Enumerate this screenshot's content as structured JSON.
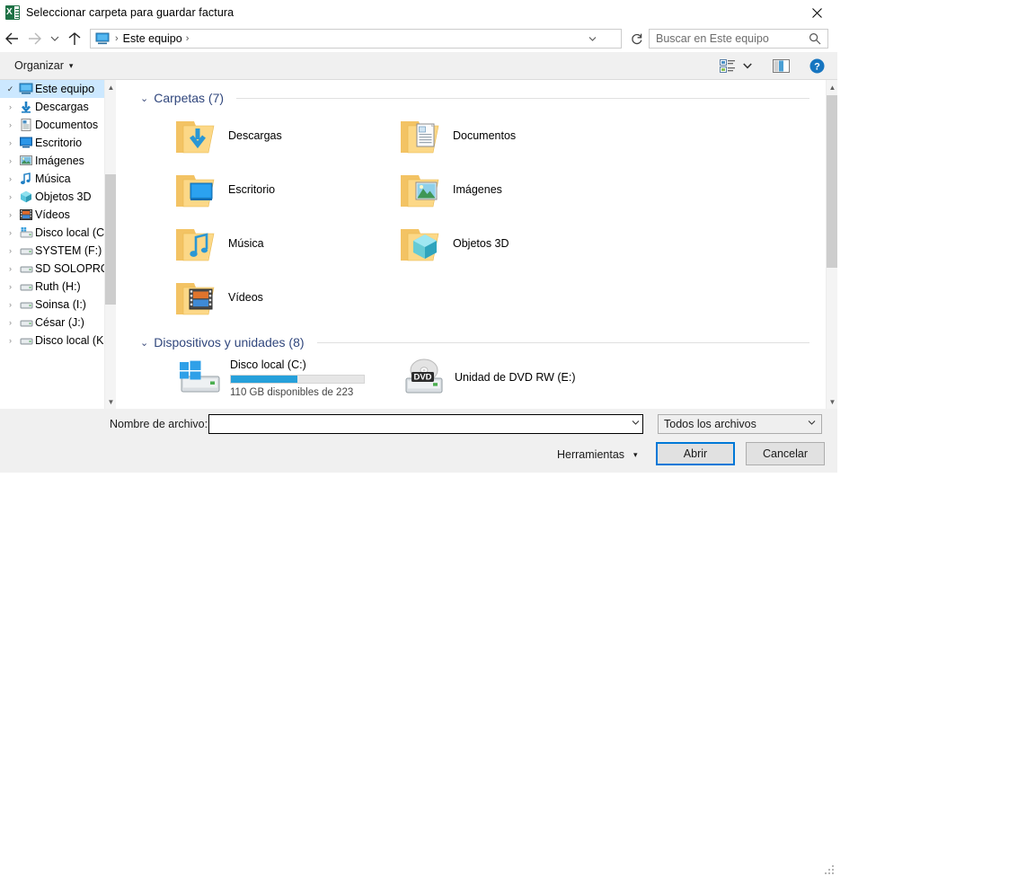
{
  "window": {
    "title": "Seleccionar carpeta para guardar factura",
    "app_icon": "excel-icon",
    "close_label": "✕"
  },
  "nav": {
    "back_icon": "arrow-left-icon",
    "forward_icon": "arrow-right-icon",
    "recent_icon": "chevron-down-icon",
    "up_icon": "arrow-up-icon",
    "breadcrumb": {
      "root_icon": "this-pc-icon",
      "sep1": "›",
      "item": "Este equipo",
      "sep2": "›"
    },
    "address_dropdown_icon": "chevron-down-icon",
    "refresh_icon": "refresh-icon",
    "search": {
      "placeholder": "Buscar en Este equipo",
      "icon": "search-icon"
    }
  },
  "commandbar": {
    "organize_label": "Organizar",
    "organize_caret": "▾",
    "view_icon": "view-options-icon",
    "view_caret": "▾",
    "pane_icon": "preview-pane-icon",
    "help_icon": "help-icon"
  },
  "sidebar": {
    "items": [
      {
        "label": "Este equipo",
        "icon": "this-pc-icon",
        "chevron": "✓",
        "selected": true
      },
      {
        "label": "Descargas",
        "icon": "downloads-icon",
        "chevron": "›",
        "selected": false
      },
      {
        "label": "Documentos",
        "icon": "documents-icon",
        "chevron": "›",
        "selected": false
      },
      {
        "label": "Escritorio",
        "icon": "desktop-icon",
        "chevron": "›",
        "selected": false
      },
      {
        "label": "Imágenes",
        "icon": "pictures-icon",
        "chevron": "›",
        "selected": false
      },
      {
        "label": "Música",
        "icon": "music-icon",
        "chevron": "›",
        "selected": false
      },
      {
        "label": "Objetos 3D",
        "icon": "3d-objects-icon",
        "chevron": "›",
        "selected": false
      },
      {
        "label": "Vídeos",
        "icon": "videos-icon",
        "chevron": "›",
        "selected": false
      },
      {
        "label": "Disco local (C:)",
        "icon": "hard-drive-icon",
        "chevron": "›",
        "selected": false
      },
      {
        "label": "SYSTEM (F:)",
        "icon": "drive-icon",
        "chevron": "›",
        "selected": false
      },
      {
        "label": "SD SOLOPRO (G",
        "icon": "drive-icon",
        "chevron": "›",
        "selected": false
      },
      {
        "label": "Ruth (H:)",
        "icon": "drive-icon",
        "chevron": "›",
        "selected": false
      },
      {
        "label": "Soinsa (I:)",
        "icon": "drive-icon",
        "chevron": "›",
        "selected": false
      },
      {
        "label": "César (J:)",
        "icon": "drive-icon",
        "chevron": "›",
        "selected": false
      },
      {
        "label": "Disco local (K:)",
        "icon": "drive-icon",
        "chevron": "›",
        "selected": false
      }
    ]
  },
  "main": {
    "groups": [
      {
        "title": "Carpetas (7)",
        "chevron": "⌄",
        "type": "folders",
        "items": [
          {
            "name": "Descargas",
            "icon": "folder-downloads-icon"
          },
          {
            "name": "Documentos",
            "icon": "folder-documents-icon"
          },
          {
            "name": "Escritorio",
            "icon": "folder-desktop-icon"
          },
          {
            "name": "Imágenes",
            "icon": "folder-pictures-icon"
          },
          {
            "name": "Música",
            "icon": "folder-music-icon"
          },
          {
            "name": "Objetos 3D",
            "icon": "folder-3d-icon"
          },
          {
            "name": "Vídeos",
            "icon": "folder-videos-icon"
          }
        ]
      },
      {
        "title": "Dispositivos y unidades (8)",
        "chevron": "⌄",
        "type": "drives",
        "items": [
          {
            "name": "Disco local (C:)",
            "icon": "windows-drive-icon",
            "capacity_text": "110 GB disponibles de 223",
            "used_percent": 50
          },
          {
            "name": "Unidad de DVD RW (E:)",
            "icon": "dvd-drive-icon",
            "capacity_text": "",
            "used_percent": null
          }
        ]
      }
    ]
  },
  "footer": {
    "filename_label": "Nombre de archivo:",
    "filename_value": "",
    "filename_dropdown_icon": "chevron-down-icon",
    "filter_value": "Todos los archivos",
    "filter_dropdown_icon": "chevron-down-icon",
    "tools_label": "Herramientas",
    "tools_caret": "▾",
    "open_label": "Abrir",
    "cancel_label": "Cancelar"
  },
  "colors": {
    "accent": "#0078d7",
    "selection": "#cce8ff",
    "group_header": "#31477d",
    "drive_bar": "#26a0da",
    "excel_green": "#1e7145"
  }
}
